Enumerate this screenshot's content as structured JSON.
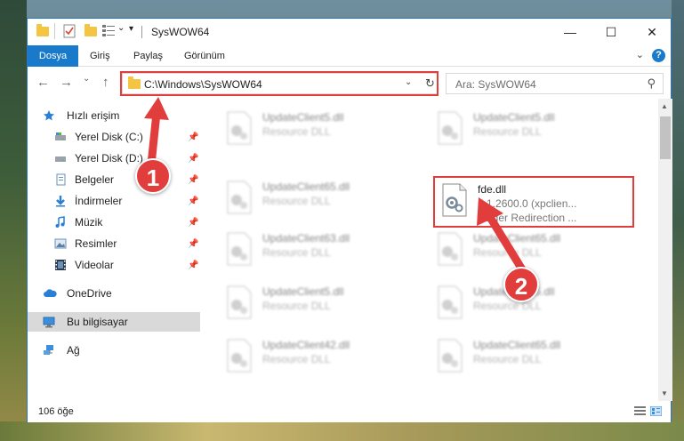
{
  "window": {
    "title": "SysWOW64",
    "controls": {
      "minimize": "—",
      "maximize": "☐",
      "close": "✕"
    }
  },
  "ribbon": {
    "tabs": [
      {
        "label": "Dosya",
        "active": true
      },
      {
        "label": "Giriş",
        "active": false
      },
      {
        "label": "Paylaş",
        "active": false
      },
      {
        "label": "Görünüm",
        "active": false
      }
    ],
    "help": "?",
    "expand": "⌄"
  },
  "nav": {
    "back": "←",
    "forward": "→",
    "recent": "⌄",
    "up": "↑",
    "address": "C:\\Windows\\SysWOW64",
    "address_dropdown": "⌄",
    "refresh": "↻",
    "search_placeholder": "Ara: SysWOW64",
    "search_icon": "⚲"
  },
  "navpane": {
    "quick_access": "Hızlı erişim",
    "pinned": [
      {
        "label": "Yerel Disk (C:)",
        "icon": "drive-icon"
      },
      {
        "label": "Yerel Disk (D:)",
        "icon": "drive-icon"
      },
      {
        "label": "Belgeler",
        "icon": "documents-icon"
      },
      {
        "label": "İndirmeler",
        "icon": "downloads-icon"
      },
      {
        "label": "Müzik",
        "icon": "music-icon"
      },
      {
        "label": "Resimler",
        "icon": "pictures-icon"
      },
      {
        "label": "Videolar",
        "icon": "videos-icon"
      }
    ],
    "pin_glyph": "📌",
    "onedrive": "OneDrive",
    "this_pc": "Bu bilgisayar",
    "network": "Ağ"
  },
  "files": {
    "left": [
      {
        "name": "UpdateClient5.dll",
        "desc": "Resource DLL"
      },
      {
        "name": "UpdateClient65.dll",
        "desc": "Resource DLL"
      },
      {
        "name": "UpdateClient63.dll",
        "desc": "Resource DLL"
      },
      {
        "name": "UpdateClient5.dll",
        "desc": "Resource DLL"
      },
      {
        "name": "UpdateClient42.dll",
        "desc": "Resource DLL"
      }
    ],
    "right": [
      {
        "name": "UpdateClient5.dll",
        "desc": "Resource DLL"
      },
      {
        "name": "UpdateClient65.dll",
        "desc": "Resource DLL"
      },
      {
        "name": "UpdateClient5.dll",
        "desc": "Resource DLL"
      },
      {
        "name": "UpdateClient65.dll",
        "desc": "Resource DLL"
      }
    ],
    "selected": {
      "name": "fde.dll",
      "version": "5.1.2600.0 (xpclien...",
      "desc": "Folder Redirection ..."
    }
  },
  "status": {
    "count": "106 öğe"
  },
  "annotations": {
    "step1": "1",
    "step2": "2"
  },
  "colors": {
    "accent": "#1979ca",
    "highlight": "#e23d3d",
    "folder": "#f4c542"
  }
}
